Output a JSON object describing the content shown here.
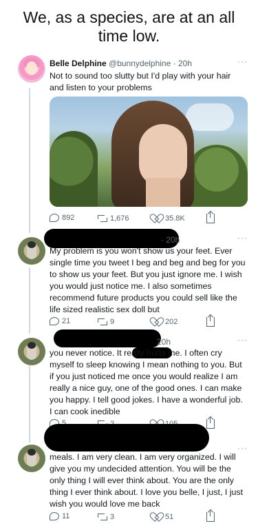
{
  "caption": "We, as a species, are at an all time low.",
  "tweets": [
    {
      "name": "Belle Delphine",
      "handle": "@bunnydelphine",
      "time": "· 20h",
      "text": "Not to sound too slutty but I'd play with your hair and listen to your problems",
      "replies": "892",
      "retweets": "1,676",
      "likes": "35.8K"
    },
    {
      "time": "· 20h",
      "text": "My problem is you won't show us your feet. Ever single time you tweet I beg and beg and beg for you to show us your feet. But you just ignore me. I wish you would just notice me. I also sometimes recommend future products you could sell like the life sized realistic sex doll but",
      "replies": "21",
      "retweets": "9",
      "likes": "202"
    },
    {
      "time": "20h",
      "text": "you never notice. It really hurts me. I often cry myself to sleep knowing I mean nothing to you. But if you just noticed me once you would realize I am really a nice guy, one of the good ones. I can make you happy. I tell good jokes. I have a wonderful job. I can cook inedible",
      "replies": "5",
      "retweets": "2",
      "likes": "105"
    },
    {
      "text": "meals. I am very clean. I am very organized. I will give you my undecided attention. You will be the only thing I will ever think about. You are the only thing I ever think about. I love you belle, I just, I just wish you would love me back",
      "replies": "11",
      "retweets": "3",
      "likes": "51"
    }
  ],
  "more_label": "···",
  "icons": [
    "reply-icon",
    "retweet-icon",
    "like-icon",
    "share-icon"
  ]
}
